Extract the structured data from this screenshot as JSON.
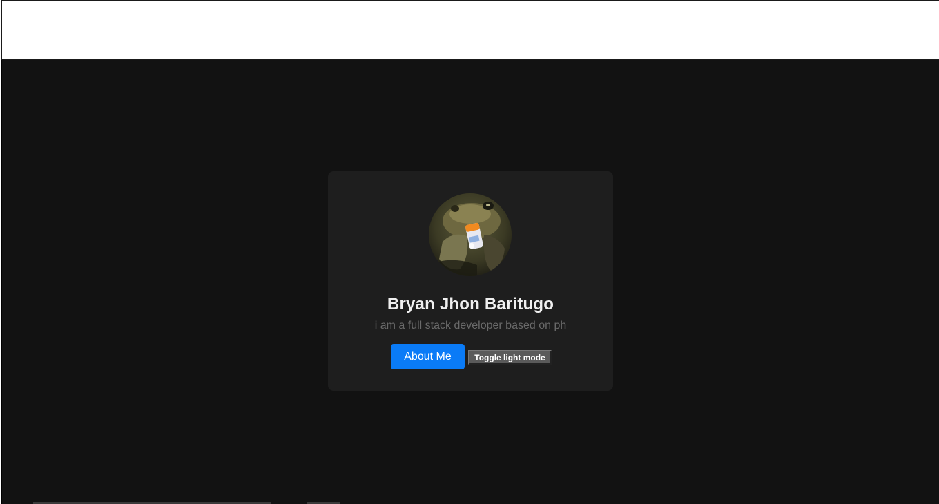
{
  "profile": {
    "name": "Bryan Jhon Baritugo",
    "tagline": "i am a full stack developer based on ph",
    "avatar_icon": "toad-with-cigar-photo"
  },
  "actions": {
    "about_label": "About Me",
    "toggle_label": "Toggle light mode"
  },
  "colors": {
    "page_background": "#121212",
    "card_background": "#1e1e1e",
    "primary_button": "#0a7bf7",
    "toggle_button": "#5a5a5a"
  }
}
